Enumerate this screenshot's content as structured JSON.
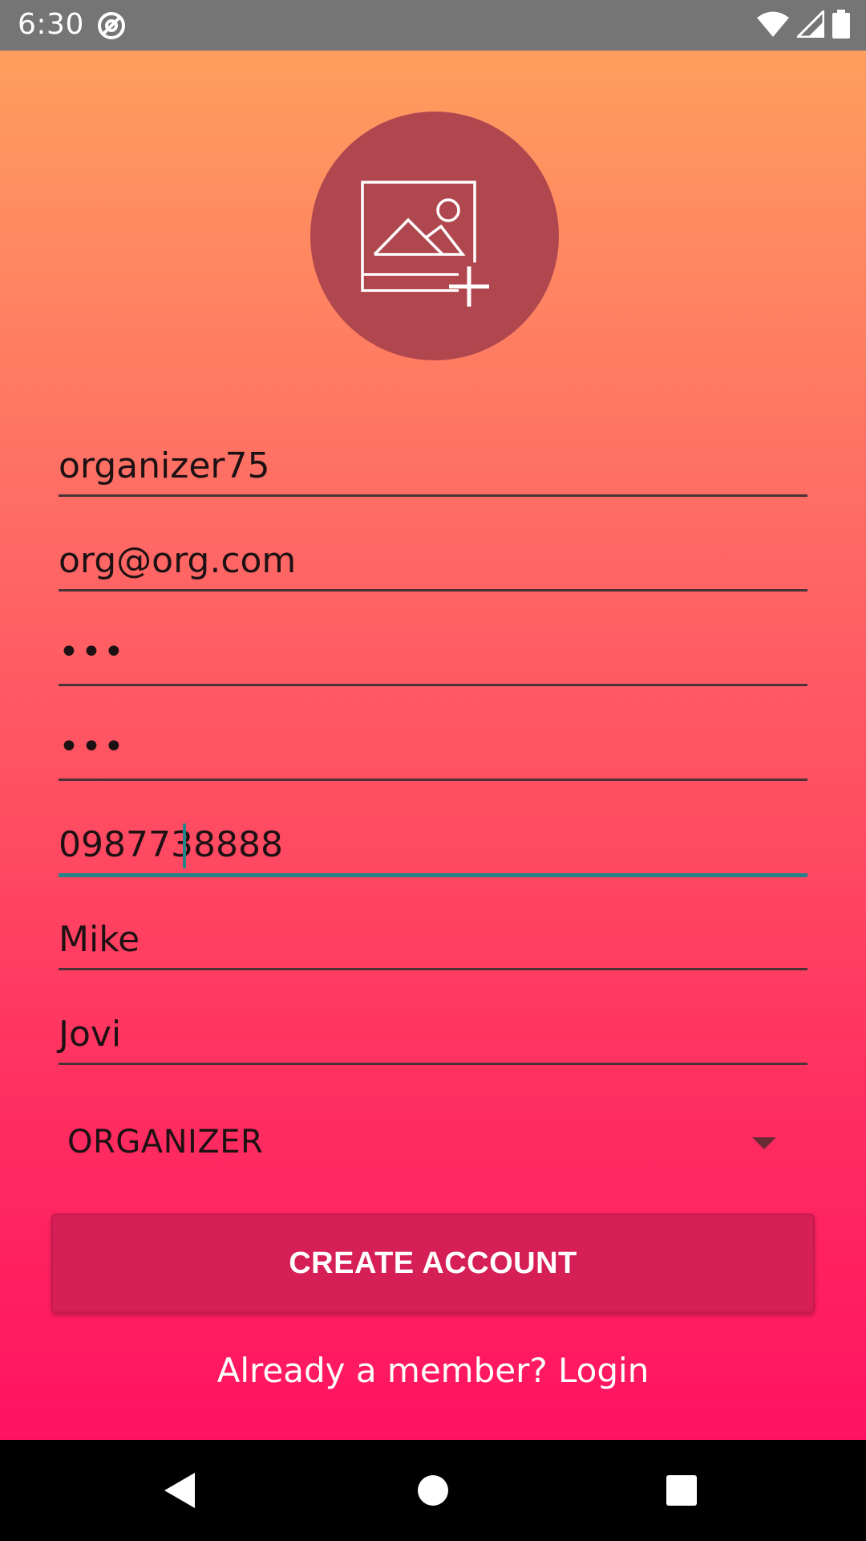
{
  "status_bar": {
    "time": "6:30",
    "app_icon": "at-sign-icon",
    "icons": [
      "wifi-icon",
      "signal-icon",
      "battery-icon"
    ]
  },
  "avatar": {
    "icon": "add-photo-icon"
  },
  "fields": {
    "username": "organizer75",
    "email": "org@org.com",
    "password": "•••",
    "confirm_password": "•••",
    "phone": "0987738888",
    "first_name": "Mike",
    "last_name": "Jovi"
  },
  "role_select": {
    "selected": "ORGANIZER"
  },
  "create_button": {
    "label": "CREATE ACCOUNT"
  },
  "login_link": {
    "label": "Already a member? Login"
  },
  "nav_bar": {
    "icons": [
      "back-icon",
      "home-icon",
      "recents-icon"
    ]
  },
  "colors": {
    "gradient_top": "#ff9e5e",
    "gradient_bottom": "#ff1263",
    "button": "#d61f57",
    "focus_accent": "#25848a",
    "avatar_circle": "#b0474f"
  }
}
